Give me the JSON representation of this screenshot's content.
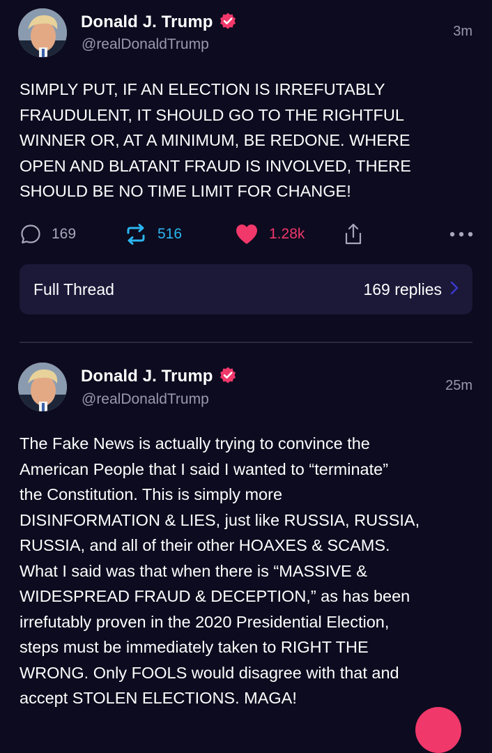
{
  "posts": [
    {
      "display_name": "Donald J. Trump",
      "handle": "@realDonaldTrump",
      "timestamp": "3m",
      "text": "SIMPLY PUT, IF AN ELECTION IS IRREFUTABLY\nFRAUDULENT, IT SHOULD GO TO THE RIGHTFUL\nWINNER OR, AT A MINIMUM, BE REDONE. WHERE\nOPEN AND BLATANT FRAUD IS INVOLVED, THERE\nSHOULD BE NO TIME LIMIT FOR CHANGE!",
      "reply_count": "169",
      "repost_count": "516",
      "like_count": "1.28k",
      "thread": {
        "label": "Full Thread",
        "replies": "169 replies"
      }
    },
    {
      "display_name": "Donald J. Trump",
      "handle": "@realDonaldTrump",
      "timestamp": "25m",
      "text": "The Fake News is actually trying to convince the\nAmerican People that I said I wanted to “terminate”\nthe Constitution. This is simply more\nDISINFORMATION & LIES, just like RUSSIA, RUSSIA,\nRUSSIA, and all of their other HOAXES & SCAMS.\nWhat I said was that when there is “MASSIVE &\nWIDESPREAD FRAUD & DECEPTION,” as has been\nirrefutably proven in the 2020 Presidential Election,\nsteps must be immediately taken to RIGHT THE\nWRONG. Only FOOLS would disagree with that and\naccept STOLEN ELECTIONS. MAGA!"
    }
  ],
  "icons": {
    "verified": "verified-badge-icon",
    "reply": "comment-icon",
    "repost": "repost-icon",
    "like": "heart-icon",
    "share": "share-icon",
    "more": "more-dots-icon",
    "chevron": "chevron-right-icon"
  },
  "colors": {
    "background": "#0d0b1f",
    "card": "#1b1838",
    "accent_like": "#f0386a",
    "accent_repost": "#2bb6f0",
    "muted_text": "#9a98ad"
  }
}
